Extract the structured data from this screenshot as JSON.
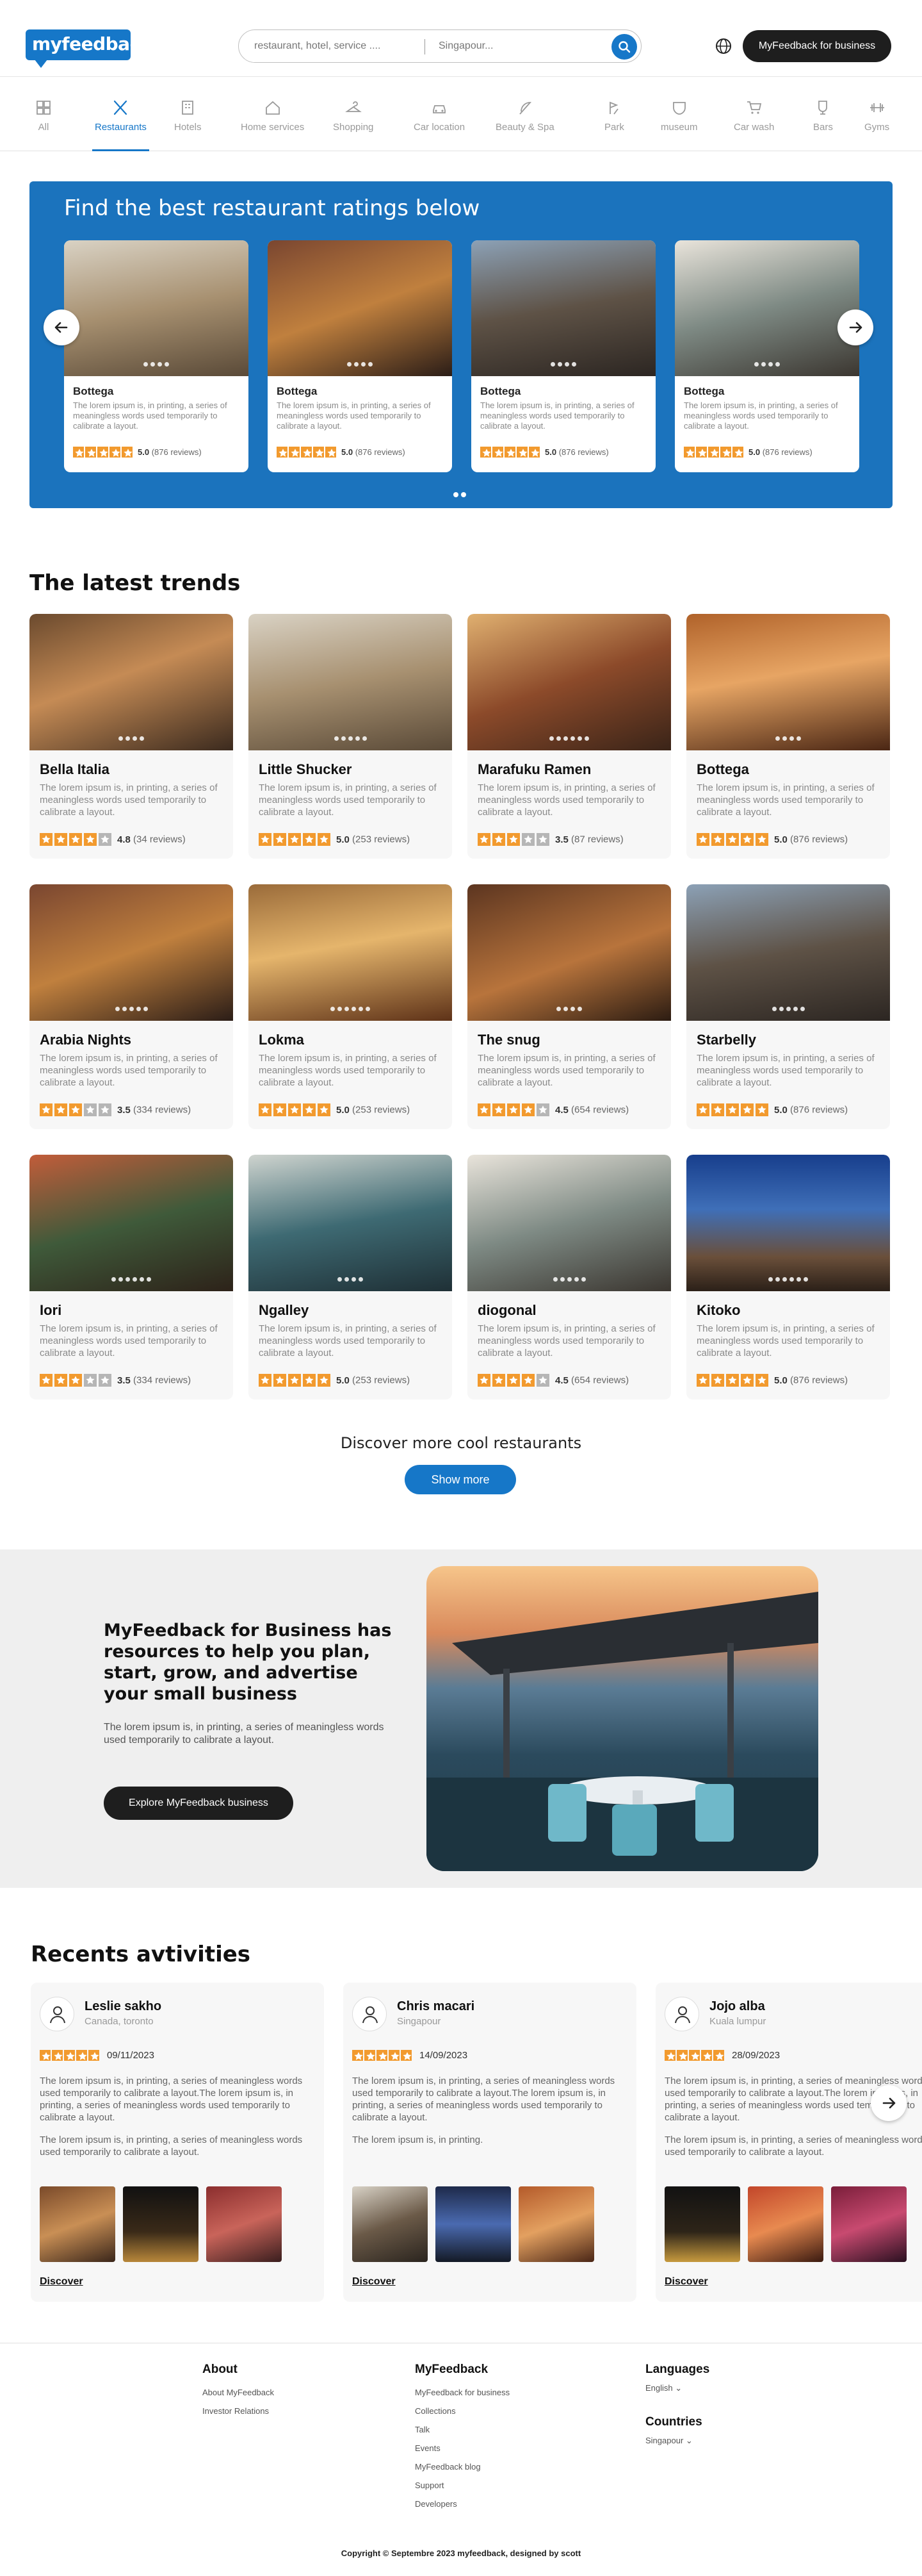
{
  "header": {
    "logo": "myfeedback",
    "search_placeholder": "restaurant, hotel, service ....",
    "location_placeholder": "Singapour...",
    "business_button": "MyFeedback for business"
  },
  "categories": [
    {
      "label": "All",
      "icon": "grid-icon"
    },
    {
      "label": "Restaurants",
      "icon": "cutlery-icon"
    },
    {
      "label": "Hotels",
      "icon": "building-icon"
    },
    {
      "label": "Home services",
      "icon": "house-icon"
    },
    {
      "label": "Shopping",
      "icon": "hanger-icon"
    },
    {
      "label": "Car location",
      "icon": "car-icon"
    },
    {
      "label": "Beauty & Spa",
      "icon": "feather-icon"
    },
    {
      "label": "Park",
      "icon": "park-icon"
    },
    {
      "label": "museum",
      "icon": "mask-icon"
    },
    {
      "label": "Car wash",
      "icon": "cart-icon"
    },
    {
      "label": "Bars",
      "icon": "glass-icon"
    },
    {
      "label": "Gyms",
      "icon": "dumbbell-icon"
    }
  ],
  "active_category": "Restaurants",
  "hero": {
    "title": "Find the best restaurant ratings below",
    "cards": [
      {
        "name": "Bottega",
        "desc": "The lorem ipsum is, in printing, a series of meaningless words used temporarily to calibrate a layout.",
        "rating": 5,
        "score": "5.0",
        "reviews": "(876 reviews)"
      },
      {
        "name": "Bottega",
        "desc": "The lorem ipsum is, in printing, a series of meaningless words used temporarily to calibrate a layout.",
        "rating": 5,
        "score": "5.0",
        "reviews": "(876 reviews)"
      },
      {
        "name": "Bottega",
        "desc": "The lorem ipsum is, in printing, a series of meaningless words used temporarily to calibrate a layout.",
        "rating": 5,
        "score": "5.0",
        "reviews": "(876 reviews)"
      },
      {
        "name": "Bottega",
        "desc": "The lorem ipsum is, in printing, a series of meaningless words used temporarily to calibrate a layout.",
        "rating": 5,
        "score": "5.0",
        "reviews": "(876 reviews)"
      }
    ]
  },
  "trends": {
    "title": "The latest trends",
    "cards": [
      {
        "name": "Bella Italia",
        "desc": "The lorem ipsum is, in printing, a series of meaningless words used temporarily to calibrate a layout.",
        "rating": 4,
        "score": "4.8",
        "reviews": "(34 reviews)"
      },
      {
        "name": "Little Shucker",
        "desc": "The lorem ipsum is, in printing, a series of meaningless words used temporarily to calibrate a layout.",
        "rating": 5,
        "score": "5.0",
        "reviews": "(253 reviews)"
      },
      {
        "name": "Marafuku Ramen",
        "desc": "The lorem ipsum is, in printing, a series of meaningless words used temporarily to calibrate a layout.",
        "rating": 3,
        "score": "3.5",
        "reviews": "(87 reviews)"
      },
      {
        "name": "Bottega",
        "desc": "The lorem ipsum is, in printing, a series of meaningless words used temporarily to calibrate a layout.",
        "rating": 5,
        "score": "5.0",
        "reviews": "(876 reviews)"
      },
      {
        "name": "Arabia Nights",
        "desc": "The lorem ipsum is, in printing, a series of meaningless words used temporarily to calibrate a layout.",
        "rating": 3,
        "score": "3.5",
        "reviews": "(334 reviews)"
      },
      {
        "name": "Lokma",
        "desc": "The lorem ipsum is, in printing, a series of meaningless words used temporarily to calibrate a layout.",
        "rating": 5,
        "score": "5.0",
        "reviews": "(253 reviews)"
      },
      {
        "name": "The snug",
        "desc": "The lorem ipsum is, in printing, a series of meaningless words used temporarily to calibrate a layout.",
        "rating": 4,
        "score": "4.5",
        "reviews": "(654 reviews)"
      },
      {
        "name": "Starbelly",
        "desc": "The lorem ipsum is, in printing, a series of meaningless words used temporarily to calibrate a layout.",
        "rating": 5,
        "score": "5.0",
        "reviews": "(876 reviews)"
      },
      {
        "name": "Iori",
        "desc": "The lorem ipsum is, in printing, a series of meaningless words used temporarily to calibrate a layout.",
        "rating": 3,
        "score": "3.5",
        "reviews": "(334 reviews)"
      },
      {
        "name": "Ngalley",
        "desc": "The lorem ipsum is, in printing, a series of meaningless words used temporarily to calibrate a layout.",
        "rating": 5,
        "score": "5.0",
        "reviews": "(253 reviews)"
      },
      {
        "name": "diogonal",
        "desc": "The lorem ipsum is, in printing, a series of meaningless words used temporarily to calibrate a layout.",
        "rating": 4,
        "score": "4.5",
        "reviews": "(654 reviews)"
      },
      {
        "name": "Kitoko",
        "desc": "The lorem ipsum is, in printing, a series of meaningless words used temporarily to calibrate a layout.",
        "rating": 5,
        "score": "5.0",
        "reviews": "(876 reviews)"
      }
    ],
    "more_text": "Discover more cool restaurants",
    "more_button": "Show more"
  },
  "business": {
    "title": "MyFeedback for Business has resources to help you plan, start, grow, and advertise your small business",
    "text": "The lorem ipsum is, in printing, a series of meaningless words used temporarily to calibrate a layout.",
    "button": "Explore MyFeedback business"
  },
  "activities": {
    "title": "Recents avtivities",
    "cards": [
      {
        "name": "Leslie sakho",
        "location": "Canada, toronto",
        "rating": 5,
        "date": "09/11/2023",
        "p1": "The lorem ipsum is, in printing, a series of meaningless words used temporarily to calibrate a layout.The lorem ipsum is, in printing, a series of meaningless words used temporarily to calibrate a layout.",
        "p2": "The lorem ipsum is, in printing, a series of meaningless words used temporarily to calibrate a layout.",
        "link": "Discover"
      },
      {
        "name": "Chris macari",
        "location": "Singapour",
        "rating": 5,
        "date": "14/09/2023",
        "p1": "The lorem ipsum is, in printing, a series of meaningless words used temporarily to calibrate a layout.The lorem ipsum is, in printing, a series of meaningless words used temporarily to calibrate a layout.",
        "p2": "The lorem ipsum is, in printing.",
        "link": "Discover"
      },
      {
        "name": "Jojo alba",
        "location": "Kuala lumpur",
        "rating": 5,
        "date": "28/09/2023",
        "p1": "The lorem ipsum is, in printing, a series of meaningless words used temporarily to calibrate a layout.The lorem ipsum is, in printing, a series of meaningless words used temporarily to calibrate a layout.",
        "p2": "The lorem ipsum is, in printing, a series of meaningless words used temporarily to calibrate a layout.",
        "link": "Discover"
      }
    ]
  },
  "footer": {
    "about": {
      "title": "About",
      "links": [
        "About MyFeedback",
        "Investor Relations"
      ]
    },
    "myfeedback": {
      "title": "MyFeedback",
      "links": [
        "MyFeedback for business",
        "Collections",
        "Talk",
        "Events",
        "MyFeedback blog",
        "Support",
        "Developers"
      ]
    },
    "languages": {
      "title": "Languages",
      "value": "English"
    },
    "countries": {
      "title": "Countries",
      "value": "Singapour"
    },
    "copyright": "Copyright © Septembre 2023 myfeedback, designed by scott"
  },
  "colors": {
    "brand": "#1677c8",
    "star": "#f29a2e",
    "dark_button": "#1e1e1e"
  }
}
